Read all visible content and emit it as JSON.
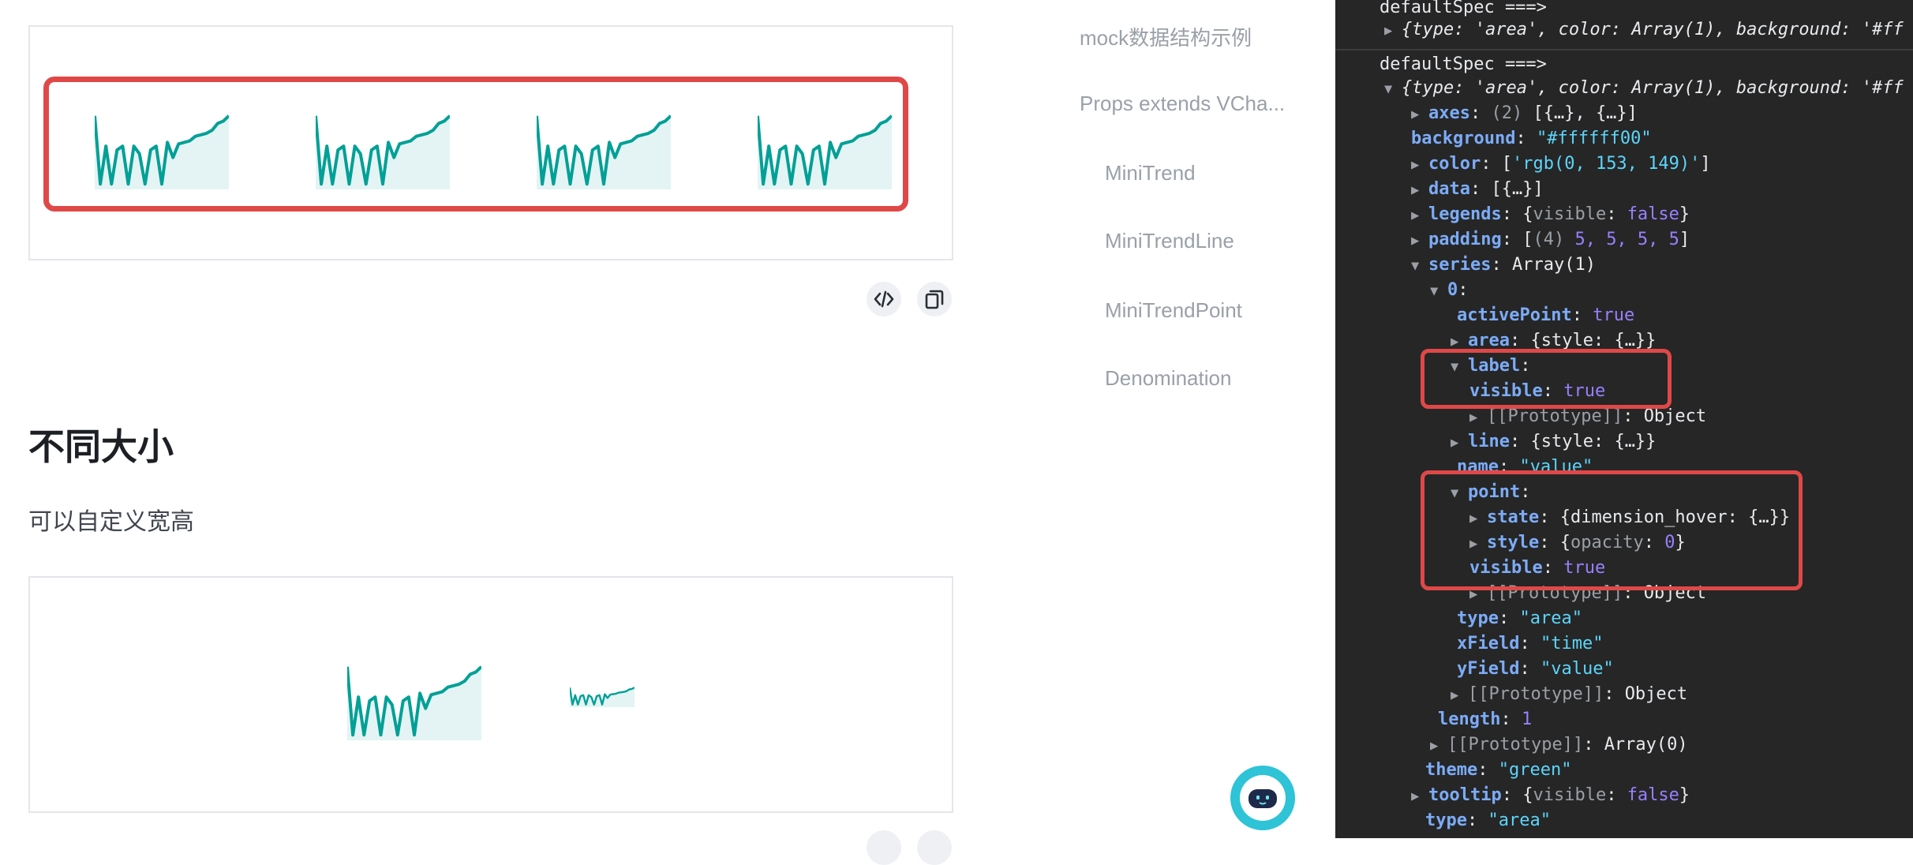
{
  "docs": {
    "section_title": "不同大小",
    "section_desc": "可以自定义宽高"
  },
  "toc": {
    "items": [
      {
        "label": "mock数据结构示例"
      },
      {
        "label": "Props extends VCha..."
      },
      {
        "label": "MiniTrend"
      },
      {
        "label": "MiniTrendLine"
      },
      {
        "label": "MiniTrendPoint"
      },
      {
        "label": "Denomination"
      }
    ]
  },
  "icons": {
    "code": "code-icon",
    "copy": "copy-icon",
    "assistant": "robot-icon"
  },
  "colors": {
    "trend_line": "#00a096",
    "trend_fill": "#d8f0ef",
    "highlight": "#e04848",
    "console_bg": "#262626"
  },
  "console": {
    "header1": "defaultSpec ===>",
    "summary1": "{type: 'area', color: Array(1), background: '#ff",
    "header2": "defaultSpec ===>",
    "summary2": "{type: 'area', color: Array(1), background: '#ff",
    "lines": [
      {
        "k": "axes",
        "sep": ": ",
        "g": "(2) ",
        "w": "[{…}, {…}]"
      },
      {
        "k": "background",
        "sep": ": ",
        "s": "\"#ffffff00\""
      },
      {
        "k": "color",
        "sep": ": ",
        "w1": "[",
        "s": "'rgb(0, 153, 149)'",
        "w2": "]"
      },
      {
        "k": "data",
        "sep": ": ",
        "w": "[{…}]"
      },
      {
        "k": "legends",
        "sep": ": ",
        "w1": "{",
        "g": "visible",
        "sep2": ": ",
        "b": "false",
        "w2": "}"
      },
      {
        "k": "padding",
        "sep": ": ",
        "g": "(4) ",
        "w1": "[",
        "n": "5, 5, 5, 5",
        "w2": "]"
      },
      {
        "k": "series",
        "sep": ": ",
        "w": "Array(1)"
      },
      {
        "k": "0",
        "sep": ":"
      },
      {
        "k": "activePoint",
        "sep": ": ",
        "b": "true"
      },
      {
        "k": "area",
        "sep": ": ",
        "w": "{style: {…}}"
      },
      {
        "k": "label",
        "sep": ":"
      },
      {
        "k": "visible",
        "sep": ": ",
        "b": "true"
      },
      {
        "k": "[[Prototype]]",
        "sep": ": ",
        "w": "Object"
      },
      {
        "k": "line",
        "sep": ": ",
        "w": "{style: {…}}"
      },
      {
        "k": "name",
        "sep": ": ",
        "s": "\"value\""
      },
      {
        "k": "point",
        "sep": ":"
      },
      {
        "k": "state",
        "sep": ": ",
        "w": "{dimension_hover: {…}}"
      },
      {
        "k": "style",
        "sep": ": ",
        "w1": "{",
        "g": "opacity",
        "sep2": ": ",
        "n": "0",
        "w2": "}"
      },
      {
        "k": "visible",
        "sep": ": ",
        "b": "true"
      },
      {
        "k": "[[Prototype]]",
        "sep": ": ",
        "w": "Object"
      },
      {
        "k": "type",
        "sep": ": ",
        "s": "\"area\""
      },
      {
        "k": "xField",
        "sep": ": ",
        "s": "\"time\""
      },
      {
        "k": "yField",
        "sep": ": ",
        "s": "\"value\""
      },
      {
        "k": "[[Prototype]]",
        "sep": ": ",
        "w": "Object"
      },
      {
        "k": "length",
        "sep": ": ",
        "n": "1"
      },
      {
        "k": "[[Prototype]]",
        "sep": ": ",
        "w": "Array(0)"
      },
      {
        "k": "theme",
        "sep": ": ",
        "s": "\"green\""
      },
      {
        "k": "tooltip",
        "sep": ": ",
        "w1": "{",
        "g": "visible",
        "sep2": ": ",
        "b": "false",
        "w2": "}"
      },
      {
        "k": "type",
        "sep": ": ",
        "s": "\"area\""
      }
    ]
  }
}
